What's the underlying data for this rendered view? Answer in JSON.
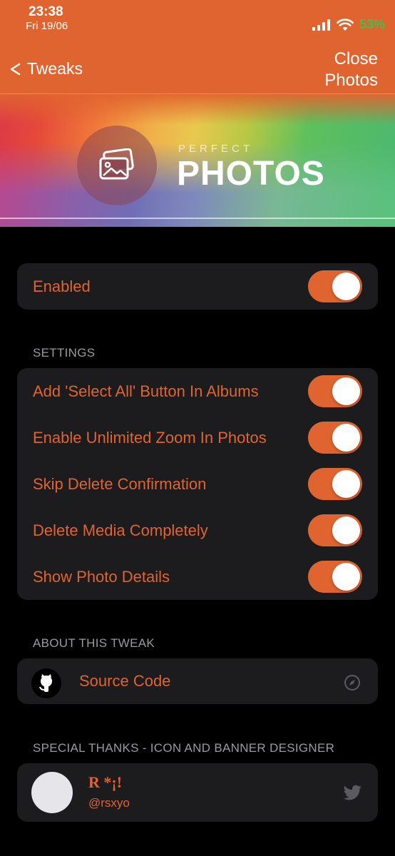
{
  "status": {
    "time": "23:38",
    "date": "Fri 19/06",
    "battery": "53%"
  },
  "nav": {
    "back_label": "Tweaks",
    "right_line1": "Close",
    "right_line2": "Photos"
  },
  "banner": {
    "brand_small": "PERFECT",
    "brand_big": "PHOTOS"
  },
  "main_toggle": {
    "label": "Enabled",
    "on": true
  },
  "settings": {
    "title": "SETTINGS",
    "items": [
      {
        "label": "Add 'Select All' Button In Albums",
        "on": true
      },
      {
        "label": "Enable Unlimited Zoom In Photos",
        "on": true
      },
      {
        "label": "Skip Delete Confirmation",
        "on": true
      },
      {
        "label": "Delete Media Completely",
        "on": true
      },
      {
        "label": "Show Photo Details",
        "on": true
      }
    ]
  },
  "about": {
    "title": "ABOUT THIS TWEAK",
    "source_label": "Source Code"
  },
  "thanks": {
    "title": "SPECIAL THANKS - ICON AND BANNER DESIGNER",
    "name": "R *¡!",
    "handle": "@rsxyo"
  },
  "colors": {
    "accent": "#e0642f",
    "cell": "#1c1c1e",
    "battery": "#3ec24a"
  },
  "icons": [
    "signal-icon",
    "wifi-icon",
    "back-chevron-icon",
    "photos-logo-icon",
    "github-icon",
    "safari-icon",
    "twitter-icon"
  ]
}
